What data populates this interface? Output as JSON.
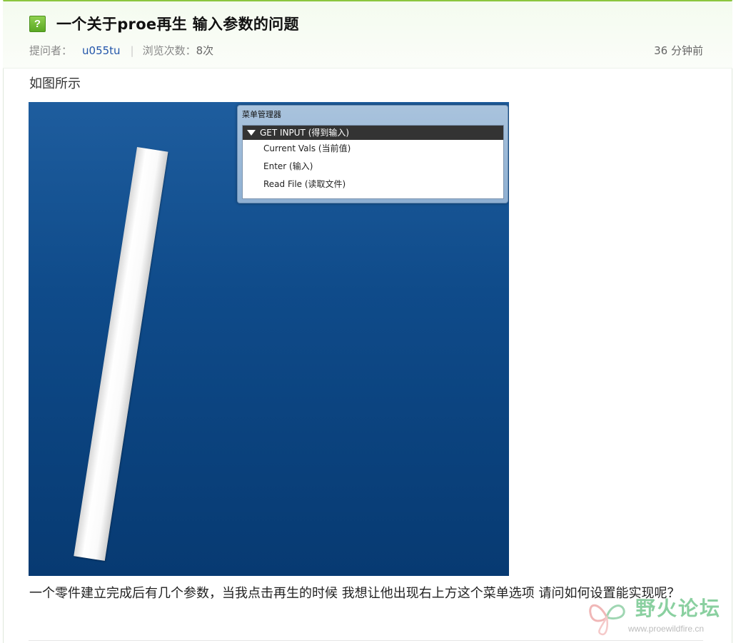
{
  "question": {
    "icon": "question-mark-icon",
    "icon_glyph": "?",
    "title": "一个关于proe再生 输入参数的问题",
    "asker_label": "提问者：",
    "asker_name": "u055tu",
    "separator": "|",
    "views_label": "浏览次数：",
    "views_count": "8次",
    "time": "36 分钟前",
    "intro": "如图所示",
    "body": "一个零件建立完成后有几个参数，当我点击再生的时候 我想让他出现右上方这个菜单选项 请问如何设置能实现呢？"
  },
  "screenshot": {
    "menu_title": "菜单管理器",
    "menu_header": "GET INPUT (得到输入)",
    "menu_items": [
      "Current Vals (当前值)",
      "Enter (输入)",
      "Read File (读取文件)"
    ]
  },
  "watermark": {
    "text": "野火论坛",
    "url": "www.proewildfire.cn"
  },
  "colors": {
    "accent_green": "#8cc63f",
    "user_link": "#2255aa",
    "viewport_blue": "#0f4b8a"
  }
}
